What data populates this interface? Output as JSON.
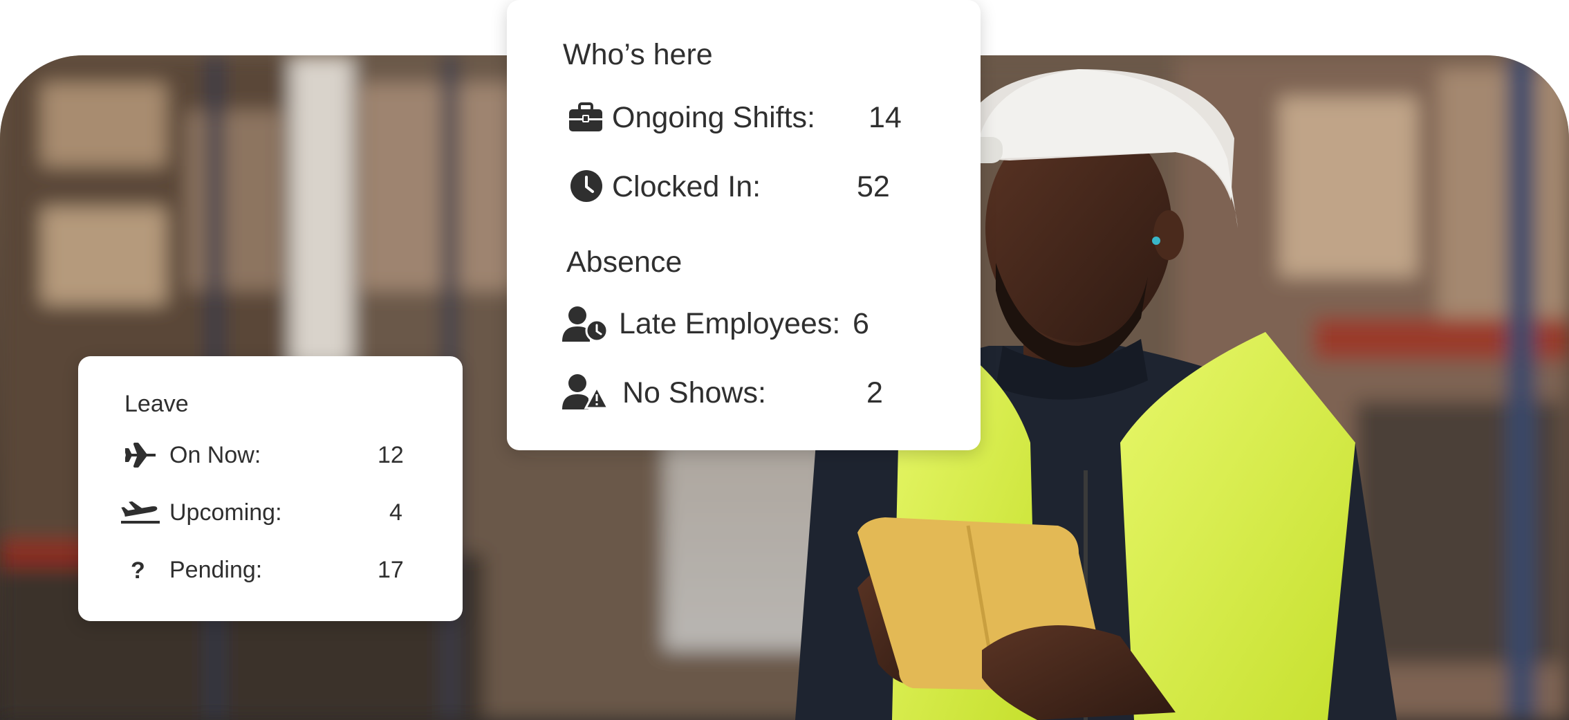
{
  "whos_here": {
    "title": "Who’s here",
    "rows": [
      {
        "icon": "briefcase-icon",
        "label": "Ongoing Shifts:",
        "value": "14"
      },
      {
        "icon": "clock-icon",
        "label": "Clocked In:",
        "value": "52"
      }
    ]
  },
  "absence": {
    "title": "Absence",
    "rows": [
      {
        "icon": "user-clock-icon",
        "label": "Late Employees:",
        "value": "6"
      },
      {
        "icon": "user-warning-icon",
        "label": "No Shows:",
        "value": "2"
      }
    ]
  },
  "leave": {
    "title": "Leave",
    "rows": [
      {
        "icon": "airplane-icon",
        "label": "On Now:",
        "value": "12"
      },
      {
        "icon": "plane-landing-icon",
        "label": "Upcoming:",
        "value": "4"
      },
      {
        "icon": "question-icon",
        "label": "Pending:",
        "value": "17"
      }
    ]
  },
  "colors": {
    "card_bg": "#ffffff",
    "text": "#2f2f2f",
    "vest": "#d9f04a",
    "tablet": "#e3b955",
    "helmet": "#efefea"
  }
}
